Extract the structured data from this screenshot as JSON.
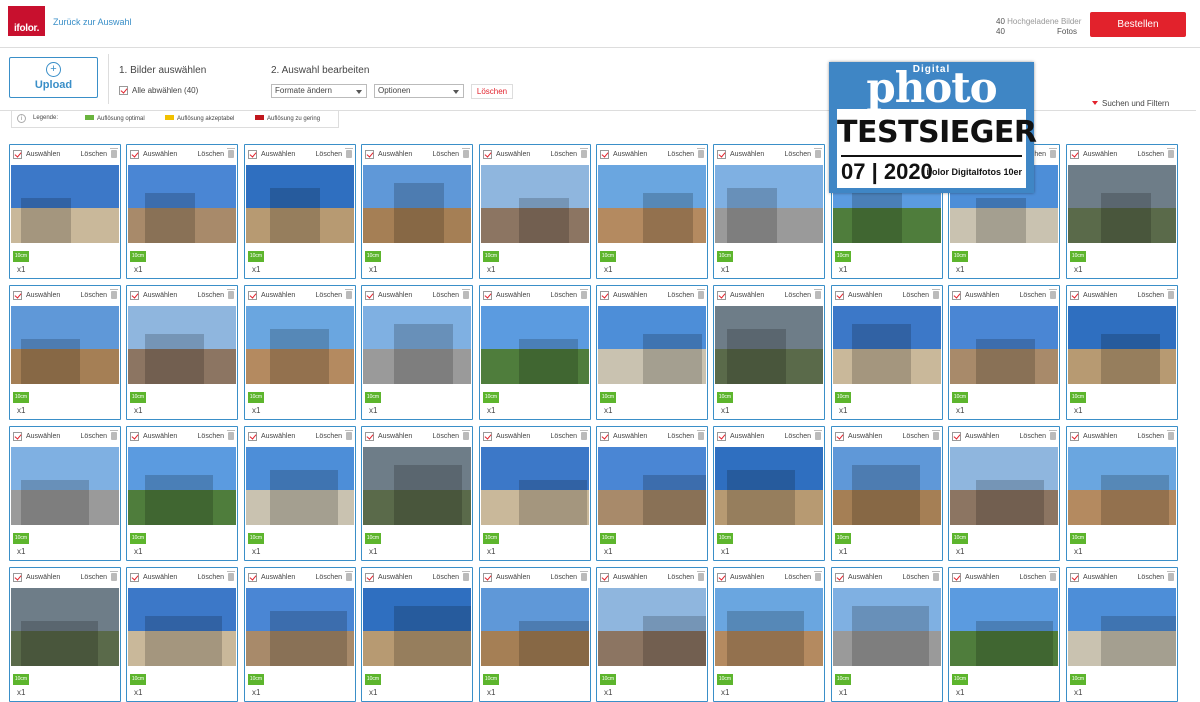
{
  "header": {
    "logo_text": "ifolor.",
    "back_link": "Zurück zur Auswahl",
    "stats_count_1": "40",
    "stats_label_1": "Hochgeladene Bilder",
    "stats_count_2": "40",
    "stats_label_2": "Fotos",
    "order_button": "Bestellen"
  },
  "toolbar": {
    "upload_button": "Upload",
    "step1_title": "1. Bilder auswählen",
    "deselect_all": "Alle abwählen (40)",
    "step2_title": "2. Auswahl bearbeiten",
    "formats_dropdown": "Formate ändern",
    "options_dropdown": "Optionen",
    "delete_button": "Löschen",
    "filter_link": "Suchen und Filtern"
  },
  "legend": {
    "label": "Legende:",
    "items": [
      {
        "label": "Auflösung optimal",
        "color": "#6ab43e"
      },
      {
        "label": "Auflösung akzeptabel",
        "color": "#f2c100"
      },
      {
        "label": "Auflösung zu gering",
        "color": "#c0171d"
      }
    ]
  },
  "card": {
    "select_label": "Auswählen",
    "delete_label": "Löschen",
    "size_badge": "10cm",
    "quantity": "x1"
  },
  "award": {
    "digital": "Digital",
    "photo": "photo",
    "testsieger": "TESTSIEGER",
    "date": "07 | 2020",
    "product": "ifolor Digitalfotos 10er"
  },
  "colors": {
    "accent_blue": "#3a8fc8",
    "brand_red": "#e2222c",
    "badge_green": "#5db52d"
  }
}
